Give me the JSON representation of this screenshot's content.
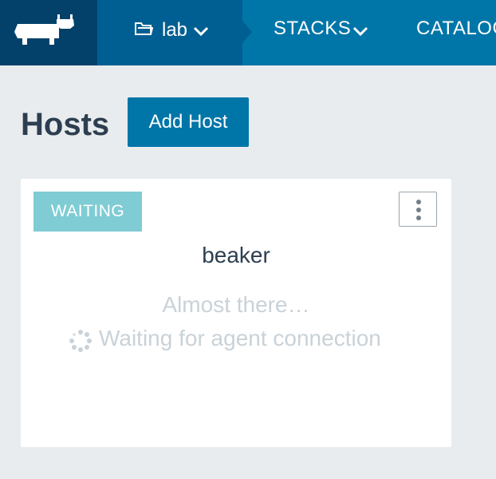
{
  "header": {
    "logo": "rancher-cattle-logo",
    "environment": {
      "label": "lab",
      "icon": "folder-icon"
    },
    "nav": [
      {
        "label": "STACKS"
      },
      {
        "label": "CATALOG"
      }
    ],
    "colors": {
      "bar": "#0075a8",
      "logo_bg": "#04416a",
      "env_bg": "#005f92"
    }
  },
  "page": {
    "title": "Hosts",
    "add_button": "Add Host"
  },
  "host": {
    "state": "WAITING",
    "name": "beaker",
    "message": "Almost there…",
    "status": "Waiting for agent connection",
    "colors": {
      "badge": "#7fccd4"
    }
  }
}
